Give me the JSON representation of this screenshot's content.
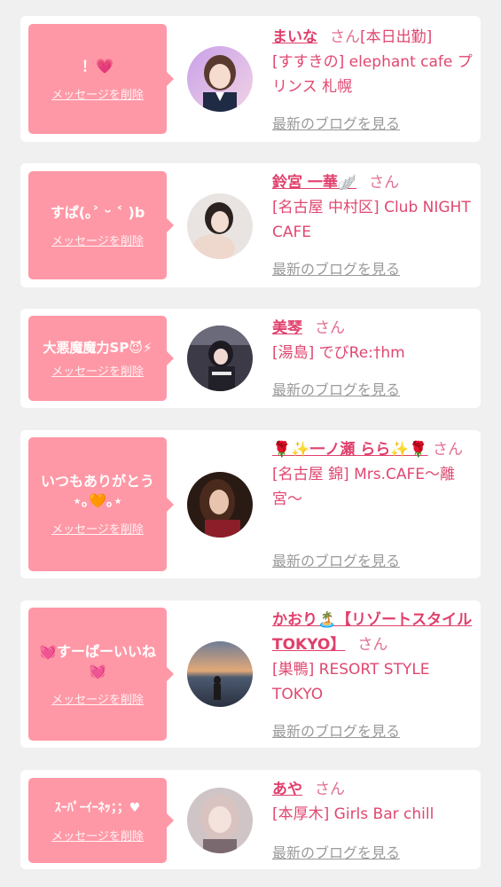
{
  "delete_label": "メッセージを削除",
  "blog_label": "最新のブログを見る",
  "san_label": "さん",
  "items": [
    {
      "message": "！💗",
      "name": "まいな",
      "tag": "[本日出勤]",
      "shop": "[すすきの] elephant cafe プリンス 札幌"
    },
    {
      "message": "すぱ(｡˃ ᵕ ˂ )b",
      "name": "鈴宮 一華🪽",
      "tag": "",
      "shop": "[名古屋 中村区] Club NIGHT CAFE"
    },
    {
      "message": "大悪魔魔力SP😈⚡",
      "name": "美琴",
      "tag": "",
      "shop": "[湯島] でびRe:†hm"
    },
    {
      "message": "いつもありがとう⋆｡🧡｡⋆",
      "name": "🌹✨一ノ瀬 らら✨🌹",
      "tag": "",
      "shop": "[名古屋 錦] Mrs.CAFE〜離宮〜"
    },
    {
      "message": "💓すーぱーいいね💓",
      "name": "かおり🏝️【リゾートスタイルTOKYO】",
      "tag": "",
      "shop": "[巣鴨] RESORT STYLE TOKYO"
    },
    {
      "message": "ｽｰﾊﾟｰｲｰﾈｯ；；♥",
      "name": "あや",
      "tag": "",
      "shop": "[本厚木] Girls Bar chill"
    }
  ],
  "colors": {
    "page_bg": "#f0f0f0",
    "card_bg": "#ffffff",
    "bubble_bg": "#ff98a6",
    "name_text": "#e0406c",
    "blog_link": "#9a9a9a"
  }
}
